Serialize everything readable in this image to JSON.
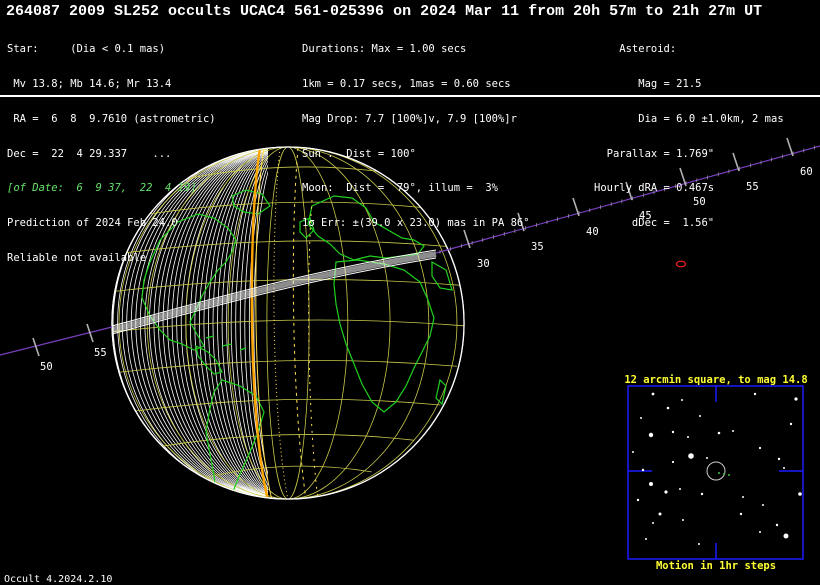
{
  "title": "264087 2009 SL252 occults UCAC4 561-025396 on 2024 Mar 11 from 20h 57m to 21h 27m UT",
  "star_col": [
    "Star:     (Dia < 0.1 mas)",
    " Mv 13.8; Mb 14.6; Mr 13.4",
    " RA =  6  8  9.7610 (astrometric)",
    "Dec =  22  4 29.337    ...",
    "[of Date:  6  9 37,  22  4 19]",
    "Prediction of 2024 Feb 24.0",
    "Reliable not available"
  ],
  "event_col": [
    "Durations: Max = 1.00 secs",
    "1km = 0.17 secs, 1mas = 0.60 secs",
    "Mag Drop: 7.7 [100%]v, 7.9 [100%]r",
    "Sun :  Dist = 100°",
    "Moon:  Dist =  79°, illum =  3%",
    "1σ Err: ±(39.0 x 23.0) mas in PA 86°"
  ],
  "asteroid_col": [
    "    Asteroid:",
    "       Mag = 21.5",
    "       Dia = 6.0 ±1.0km, 2 mas",
    "  Parallax = 1.769\"",
    "Hourly dRA = 0.467s",
    "      dDec =  1.56\""
  ],
  "path_labels": {
    "far": [
      "30",
      "35",
      "40",
      "45",
      "50",
      "55",
      "60"
    ],
    "near": [
      "50",
      "55"
    ]
  },
  "starchart": {
    "title": "12 arcmin square, to mag 14.8",
    "caption": "Motion in 1hr steps"
  },
  "footer": "Occult 4.2024.2.10",
  "colors": {
    "land": "#1fd11f",
    "grid": "#c8c84a",
    "path": "#ffa500",
    "track": "#7a3fc0",
    "chart_border": "#1a1aff",
    "chart_title": "#ffff33",
    "marker": "#ff2020"
  }
}
